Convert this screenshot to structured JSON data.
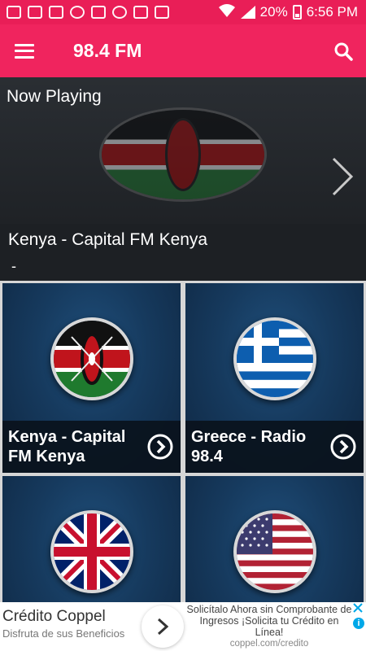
{
  "status_bar": {
    "battery_percent": "20%",
    "time": "6:56 PM"
  },
  "app_bar": {
    "title": "98.4 FM",
    "menu_icon": "hamburger-menu-icon",
    "search_icon": "search-icon"
  },
  "now_playing": {
    "label": "Now Playing",
    "station": "Kenya - Capital FM Kenya",
    "track": "-"
  },
  "stations": [
    {
      "name": "Kenya - Capital FM Kenya",
      "flag": "kenya-flag"
    },
    {
      "name": "Greece - Radio 98.4",
      "flag": "greece-flag"
    },
    {
      "name": "",
      "flag": "uk-flag"
    },
    {
      "name": "",
      "flag": "usa-flag"
    }
  ],
  "ad": {
    "title": "Crédito Coppel",
    "subtitle": "Disfruta de sus Beneficios",
    "message": "Solicítalo Ahora sin Comprobante de Ingresos ¡Solicita tu Crédito en Línea!",
    "url": "coppel.com/credito"
  },
  "colors": {
    "status_bar": "#e91e57",
    "app_bar": "#f0245e",
    "card_bg": "#163a5e"
  }
}
